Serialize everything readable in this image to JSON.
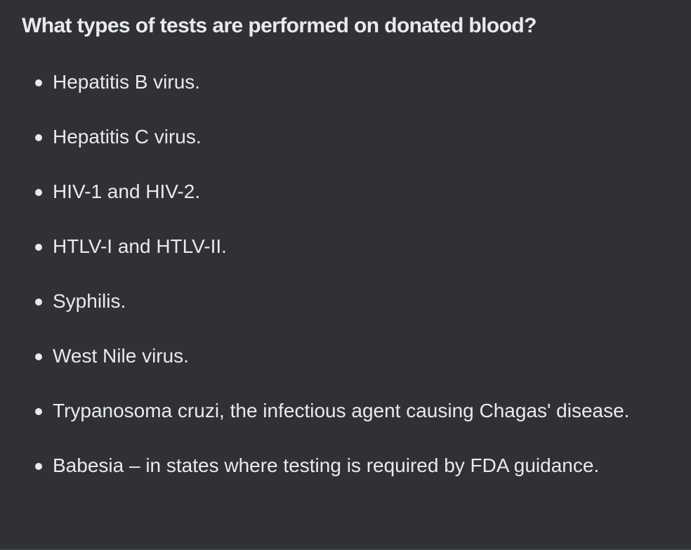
{
  "question": "What types of tests are performed on donated blood?",
  "answers": [
    "Hepatitis B virus.",
    "Hepatitis C virus.",
    "HIV-1 and HIV-2.",
    "HTLV-I and HTLV-II.",
    "Syphilis.",
    "West Nile virus.",
    "Trypanosoma cruzi, the infectious agent causing Chagas' disease.",
    "Babesia – in states where testing is required by FDA guidance."
  ],
  "colors": {
    "background": "#303134",
    "text": "#e8eaed"
  },
  "icons": {
    "bullet": "bullet-dot-icon"
  }
}
